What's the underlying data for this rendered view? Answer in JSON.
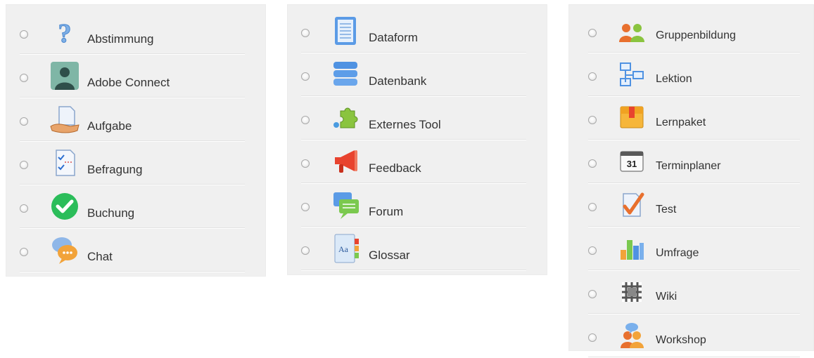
{
  "panels": [
    {
      "items": [
        {
          "label": "Abstimmung",
          "icon": "question-icon"
        },
        {
          "label": "Adobe Connect",
          "icon": "adobe-connect-icon"
        },
        {
          "label": "Aufgabe",
          "icon": "assignment-icon"
        },
        {
          "label": "Befragung",
          "icon": "survey-icon"
        },
        {
          "label": "Buchung",
          "icon": "checkmark-icon"
        },
        {
          "label": "Chat",
          "icon": "chat-icon"
        }
      ]
    },
    {
      "items": [
        {
          "label": "Dataform",
          "icon": "dataform-icon"
        },
        {
          "label": "Datenbank",
          "icon": "database-icon"
        },
        {
          "label": "Externes Tool",
          "icon": "puzzle-icon"
        },
        {
          "label": "Feedback",
          "icon": "megaphone-icon"
        },
        {
          "label": "Forum",
          "icon": "forum-icon"
        },
        {
          "label": "Glossar",
          "icon": "glossary-icon"
        }
      ]
    },
    {
      "items": [
        {
          "label": "Gruppenbildung",
          "icon": "group-icon"
        },
        {
          "label": "Lektion",
          "icon": "lesson-icon"
        },
        {
          "label": "Lernpaket",
          "icon": "package-icon"
        },
        {
          "label": "Terminplaner",
          "icon": "calendar-icon"
        },
        {
          "label": "Test",
          "icon": "quiz-icon"
        },
        {
          "label": "Umfrage",
          "icon": "chart-icon"
        },
        {
          "label": "Wiki",
          "icon": "wiki-icon"
        },
        {
          "label": "Workshop",
          "icon": "workshop-icon"
        }
      ]
    }
  ],
  "calendar_day": "31"
}
